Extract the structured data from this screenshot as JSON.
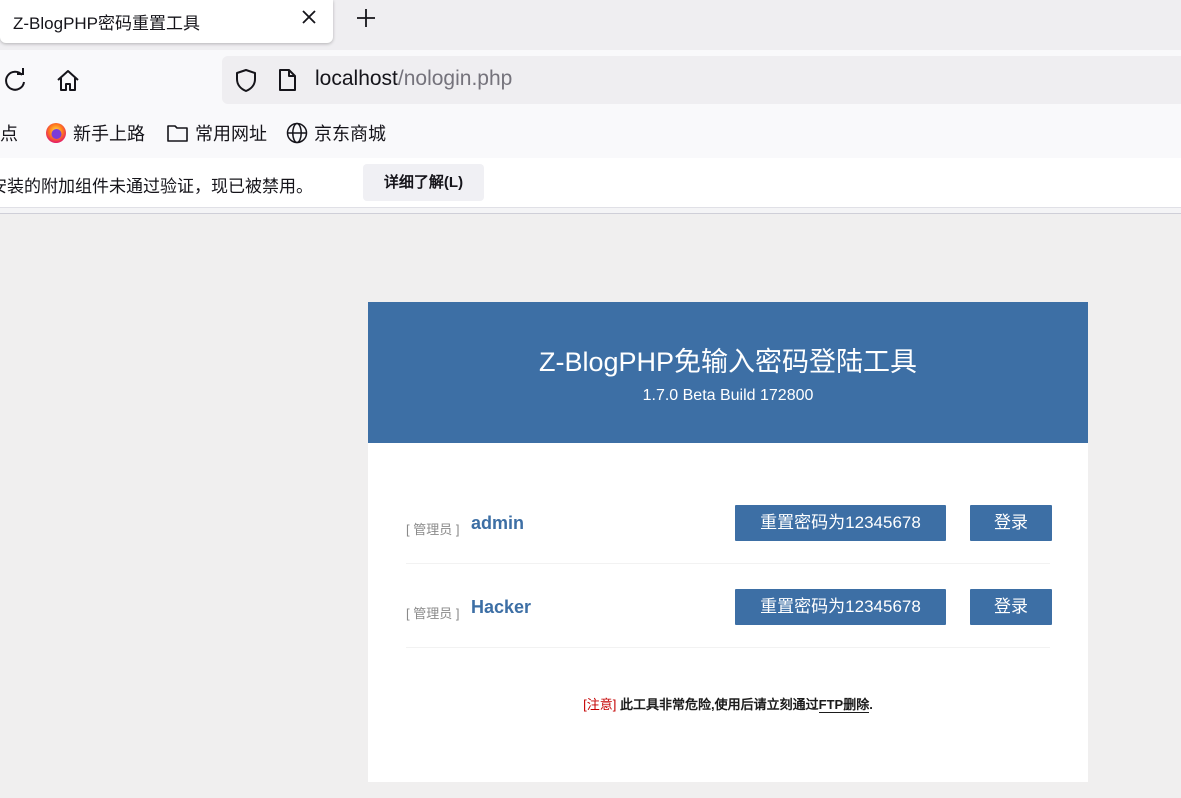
{
  "browser": {
    "tab": {
      "title": "Z-BlogPHP密码重置工具"
    },
    "url": {
      "host": "localhost",
      "path": "/nologin.php"
    },
    "bookmarks": [
      {
        "label": "站点"
      },
      {
        "label": "新手上路"
      },
      {
        "label": "常用网址"
      },
      {
        "label": "京东商城"
      }
    ],
    "notice": {
      "text": "安装的附加组件未通过验证，现已被禁用。",
      "button": "详细了解(L)"
    }
  },
  "header": {
    "title": "Z-BlogPHP免输入密码登陆工具",
    "version": "1.7.0 Beta Build 172800"
  },
  "users": [
    {
      "role": "[ 管理员 ]",
      "name": "admin",
      "reset_label": "重置密码为12345678",
      "login_label": "登录"
    },
    {
      "role": "[ 管理员 ]",
      "name": "Hacker",
      "reset_label": "重置密码为12345678",
      "login_label": "登录"
    }
  ],
  "warning": {
    "tag": "[注意]",
    "text": " 此工具非常危险,使用后请立刻通过",
    "link": "FTP删除",
    "end": "."
  },
  "colors": {
    "accent": "#3d6fa5",
    "warning": "#c40000"
  }
}
